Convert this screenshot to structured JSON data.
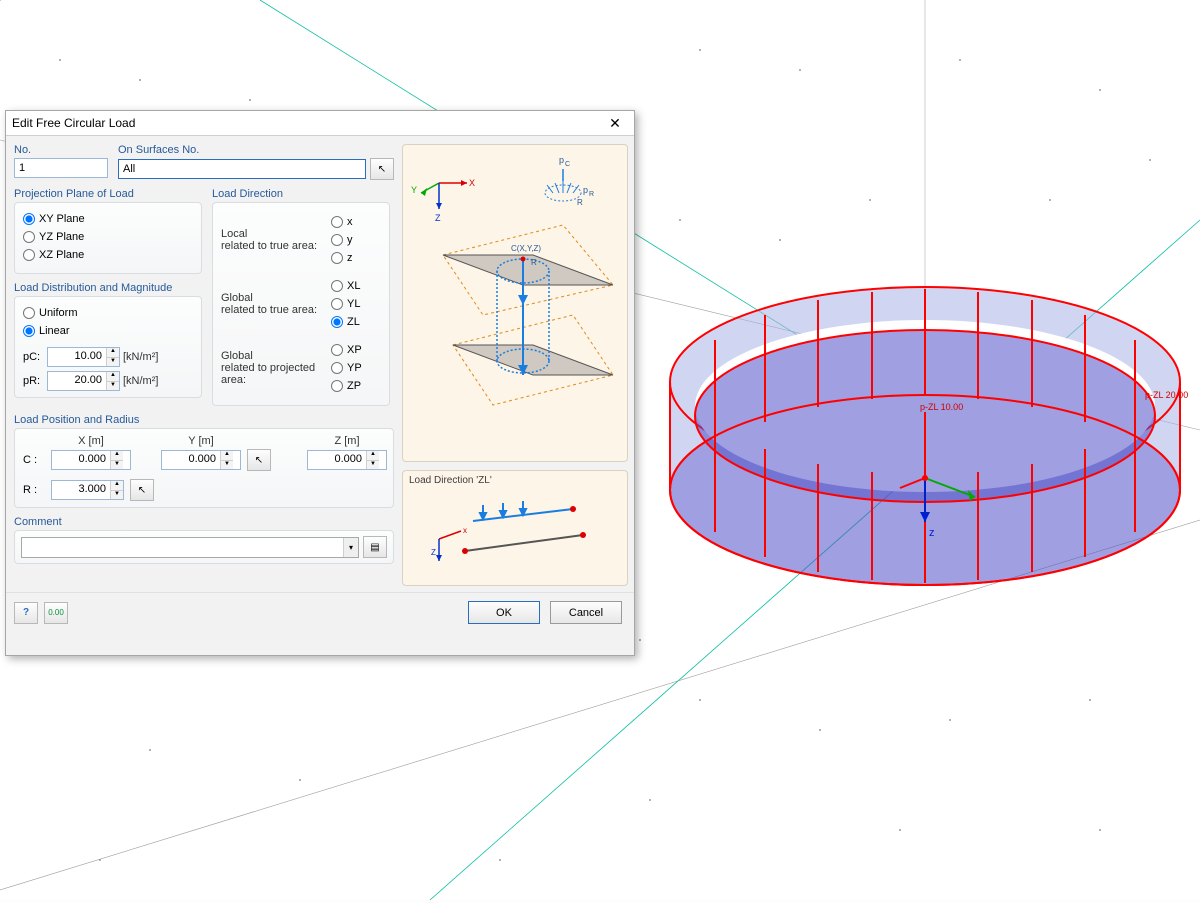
{
  "dialog": {
    "title": "Edit Free Circular Load",
    "no_group": {
      "title": "No.",
      "value": "1"
    },
    "surfaces_group": {
      "title": "On Surfaces No.",
      "value": "All"
    },
    "proj_plane": {
      "title": "Projection Plane of Load",
      "options": {
        "xy": "XY Plane",
        "yz": "YZ Plane",
        "xz": "XZ Plane"
      },
      "selected": "xy"
    },
    "distribution": {
      "title": "Load Distribution and Magnitude",
      "options": {
        "uniform": "Uniform",
        "linear": "Linear"
      },
      "selected": "linear",
      "pc_label": "pC:",
      "pc_value": "10.00",
      "pc_unit": "[kN/m²]",
      "pr_label": "pR:",
      "pr_value": "20.00",
      "pr_unit": "[kN/m²]"
    },
    "load_direction": {
      "title": "Load Direction",
      "local_label": "Local\nrelated to true area:",
      "global_true_label": "Global\nrelated to true area:",
      "global_proj_label": "Global\nrelated to projected area:",
      "options": {
        "x": "x",
        "y": "y",
        "z": "z",
        "XL": "XL",
        "YL": "YL",
        "ZL": "ZL",
        "XP": "XP",
        "YP": "YP",
        "ZP": "ZP"
      },
      "selected": "ZL"
    },
    "position": {
      "title": "Load Position and Radius",
      "x_hdr": "X  [m]",
      "y_hdr": "Y  [m]",
      "z_hdr": "Z  [m]",
      "c_label": "C :",
      "r_label": "R :",
      "cx": "0.000",
      "cy": "0.000",
      "cz": "0.000",
      "r": "3.000"
    },
    "comment": {
      "title": "Comment",
      "value": ""
    },
    "illus_small_caption": "Load Direction 'ZL'",
    "buttons": {
      "ok": "OK",
      "cancel": "Cancel"
    }
  },
  "viewport": {
    "labels": {
      "pzl10": "p-ZL 10.00",
      "pzl20": "p-ZL 20.00",
      "axis_z": "z"
    }
  }
}
